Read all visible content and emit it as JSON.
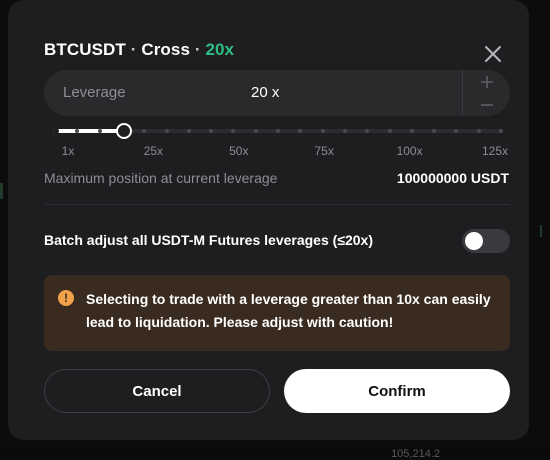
{
  "dialog": {
    "symbol": "BTCUSDT",
    "sep": "·",
    "margin_mode": "Cross",
    "leverage_tag": "20x",
    "close_icon": "close-icon"
  },
  "leverage_input": {
    "label": "Leverage",
    "value": "20 x",
    "plus_icon": "plus-icon",
    "minus_icon": "minus-icon"
  },
  "slider": {
    "ticks": [
      "1x",
      "25x",
      "50x",
      "75x",
      "100x",
      "125x"
    ],
    "min": 1,
    "max": 125,
    "value": 20
  },
  "max_position": {
    "label": "Maximum position at current leverage",
    "value": "100000000 USDT"
  },
  "batch_adjust": {
    "label": "Batch adjust all USDT-M Futures leverages (≤20x)",
    "enabled": false
  },
  "warning": {
    "icon": "warning-icon",
    "text": "Selecting to trade with a leverage greater than 10x can easily lead to liquidation. Please adjust with caution!"
  },
  "buttons": {
    "cancel": "Cancel",
    "confirm": "Confirm"
  },
  "background": {
    "partial_price": "105,214.2"
  },
  "colors": {
    "accent": "#2ebd85",
    "warning_bg": "#3a2b21",
    "warning_icon": "#f0a34a",
    "modal_bg": "#1e1e20"
  }
}
